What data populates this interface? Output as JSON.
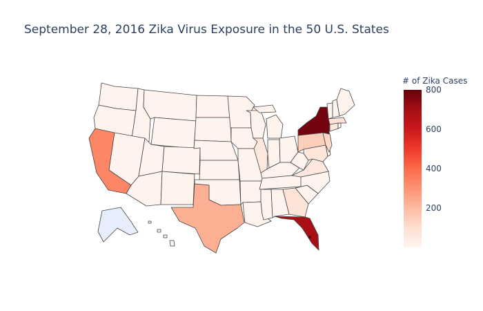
{
  "title": "September 28, 2016 Zika Virus Exposure in the 50 U.S. States",
  "colorbar": {
    "title": "# of Zika Cases",
    "ticks": [
      "800",
      "600",
      "400",
      "200"
    ],
    "tick_values": [
      800,
      600,
      400,
      200
    ],
    "range": [
      0,
      800
    ],
    "colorscale": [
      "#fff5f0",
      "#fee0d2",
      "#fcbba1",
      "#fc9272",
      "#fb6a4a",
      "#ef3b2c",
      "#cb181d",
      "#a50f15",
      "#67000d"
    ]
  },
  "map_data": {
    "type": "choropleth",
    "scope": "usa",
    "estimated_cases": {
      "New York": 780,
      "Florida": 690,
      "California": 330,
      "Texas": 230,
      "Pennsylvania": 150,
      "New Jersey": 120,
      "Massachusetts": 90,
      "Georgia": 80,
      "Illinois": 60,
      "Virginia": 60,
      "Maryland": 70,
      "Connecticut": 60,
      "Alaska": 0
    }
  }
}
